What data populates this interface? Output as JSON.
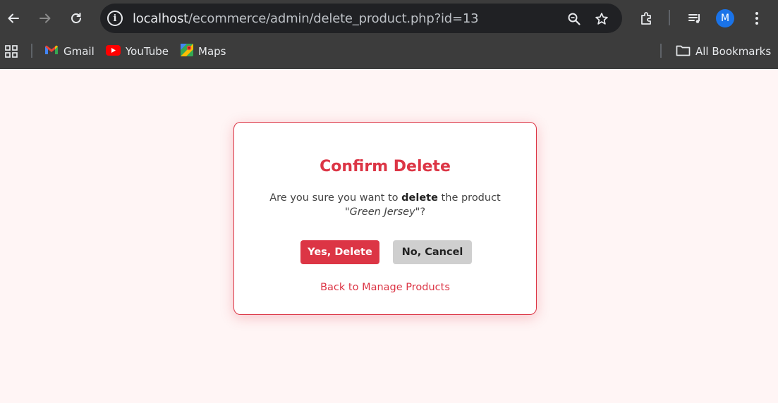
{
  "browser": {
    "url_host": "localhost",
    "url_path": "/ecommerce/admin/delete_product.php?id=13",
    "avatar_letter": "M",
    "bookmarks": [
      {
        "label": "Gmail",
        "icon": "gmail-icon"
      },
      {
        "label": "YouTube",
        "icon": "youtube-icon"
      },
      {
        "label": "Maps",
        "icon": "maps-icon"
      }
    ],
    "all_bookmarks_label": "All Bookmarks"
  },
  "dialog": {
    "title": "Confirm Delete",
    "message_prefix": "Are you sure you want to ",
    "message_bold": "delete",
    "message_middle": " the product \"",
    "product_name": "Green Jersey",
    "message_suffix": "\"?",
    "yes_label": "Yes, Delete",
    "no_label": "No, Cancel",
    "back_link": "Back to Manage Products"
  },
  "colors": {
    "accent": "#dc3545",
    "page_bg": "#fff5f5",
    "chrome_bg": "#3c3c3c"
  }
}
